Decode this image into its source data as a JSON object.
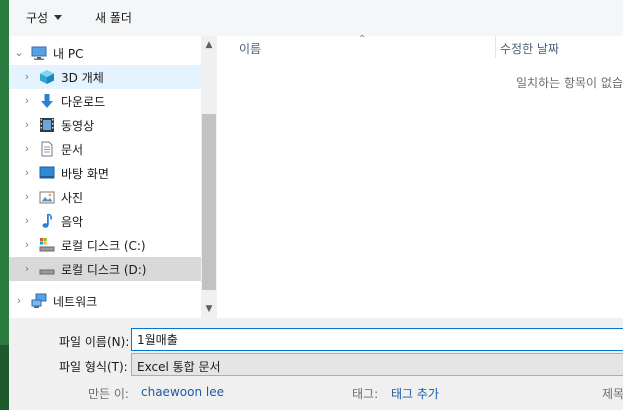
{
  "toolbar": {
    "organize_label": "구성",
    "new_folder_label": "새 폴더"
  },
  "nav": {
    "items": [
      {
        "label": "내 PC",
        "icon": "pc-icon"
      },
      {
        "label": "3D 개체",
        "icon": "3d-objects-icon"
      },
      {
        "label": "다운로드",
        "icon": "download-icon"
      },
      {
        "label": "동영상",
        "icon": "video-icon"
      },
      {
        "label": "문서",
        "icon": "document-icon"
      },
      {
        "label": "바탕 화면",
        "icon": "desktop-icon"
      },
      {
        "label": "사진",
        "icon": "picture-icon"
      },
      {
        "label": "음악",
        "icon": "music-icon"
      },
      {
        "label": "로컬 디스크 (C:)",
        "icon": "drive-c-icon"
      },
      {
        "label": "로컬 디스크 (D:)",
        "icon": "drive-d-icon"
      },
      {
        "label": "네트워크",
        "icon": "network-icon"
      }
    ]
  },
  "content": {
    "col_name": "이름",
    "col_date": "수정한 날짜",
    "empty_message": "일치하는 항목이 없습니다."
  },
  "form": {
    "filename_label": "파일 이름(N):",
    "filename_value": "1월매출",
    "filetype_label": "파일 형식(T):",
    "filetype_value": "Excel 통합 문서"
  },
  "meta": {
    "author_label": "만든 이:",
    "author_value": "chaewoon lee",
    "tags_label": "태그:",
    "tags_value": "태그 추가",
    "title_label": "제목:"
  },
  "colors": {
    "accent": "#0078d7",
    "hover": "#e5f3ff",
    "selected": "#d9d9d9",
    "link": "#1e5aa8"
  }
}
